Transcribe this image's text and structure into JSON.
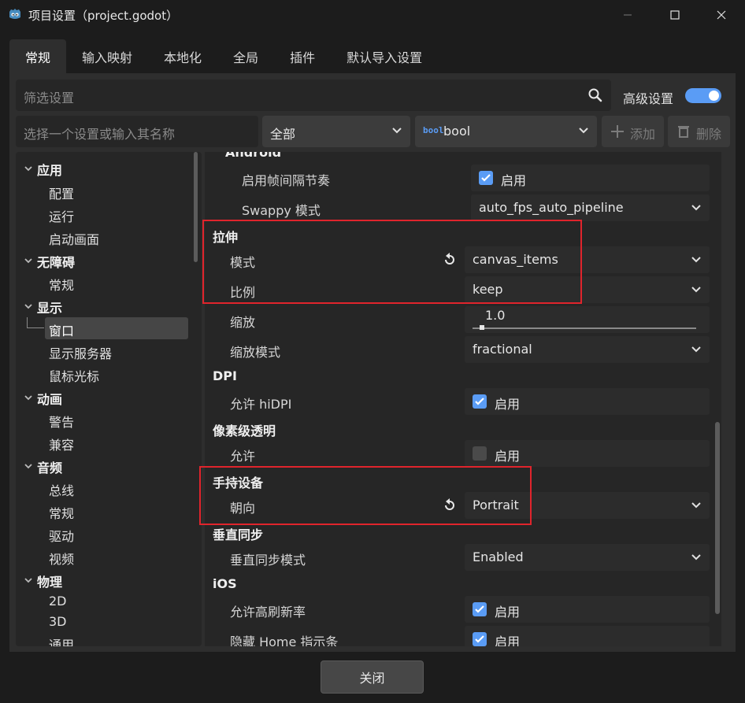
{
  "window": {
    "title": "项目设置（project.godot）",
    "icon": "godot-icon"
  },
  "tabs": [
    "常规",
    "输入映射",
    "本地化",
    "全局",
    "插件",
    "默认导入设置"
  ],
  "active_tab": 0,
  "filter": {
    "placeholder": "筛选设置"
  },
  "advanced": {
    "label": "高级设置",
    "enabled": true
  },
  "name_input": {
    "placeholder": "选择一个设置或输入其名称"
  },
  "scope_dropdown": {
    "value": "全部"
  },
  "type_dropdown": {
    "icon_text": "bool",
    "value": "bool"
  },
  "buttons": {
    "add": "添加",
    "delete": "删除",
    "close": "关闭"
  },
  "tree": [
    {
      "label": "应用",
      "section": true
    },
    {
      "label": "配置"
    },
    {
      "label": "运行"
    },
    {
      "label": "启动画面"
    },
    {
      "label": "无障碍",
      "section": true
    },
    {
      "label": "常规"
    },
    {
      "label": "显示",
      "section": true
    },
    {
      "label": "窗口",
      "selected": true
    },
    {
      "label": "显示服务器"
    },
    {
      "label": "鼠标光标"
    },
    {
      "label": "动画",
      "section": true
    },
    {
      "label": "警告"
    },
    {
      "label": "兼容"
    },
    {
      "label": "音频",
      "section": true
    },
    {
      "label": "总线"
    },
    {
      "label": "常规"
    },
    {
      "label": "驱动"
    },
    {
      "label": "视频"
    },
    {
      "label": "物理",
      "section": true
    },
    {
      "label": "2D"
    },
    {
      "label": "3D"
    },
    {
      "label": "通用"
    }
  ],
  "settings": {
    "android_header": "Android",
    "frame_pacing": {
      "label": "启用帧间隔节奏",
      "value": "启用",
      "checked": true
    },
    "swappy_mode": {
      "label": "Swappy 模式",
      "value": "auto_fps_auto_pipeline"
    },
    "stretch_header": "拉伸",
    "stretch_mode": {
      "label": "模式",
      "value": "canvas_items"
    },
    "stretch_aspect": {
      "label": "比例",
      "value": "keep"
    },
    "stretch_scale": {
      "label": "缩放",
      "value": "1.0"
    },
    "stretch_scale_mode": {
      "label": "缩放模式",
      "value": "fractional"
    },
    "dpi_header": "DPI",
    "allow_hidpi": {
      "label": "允许 hiDPI",
      "value": "启用",
      "checked": true
    },
    "transparency_header": "像素级透明",
    "allow_transparency": {
      "label": "允许",
      "value": "启用",
      "checked": false
    },
    "handheld_header": "手持设备",
    "orientation": {
      "label": "朝向",
      "value": "Portrait"
    },
    "vsync_header": "垂直同步",
    "vsync_mode": {
      "label": "垂直同步模式",
      "value": "Enabled"
    },
    "ios_header": "iOS",
    "allow_high_refresh": {
      "label": "允许高刷新率",
      "value": "启用",
      "checked": true
    },
    "hide_home_indicator": {
      "label": "隐藏 Home 指示条",
      "value": "启用",
      "checked": true
    }
  },
  "colors": {
    "accent": "#5a9cf5",
    "highlight_border": "#e0242c"
  }
}
